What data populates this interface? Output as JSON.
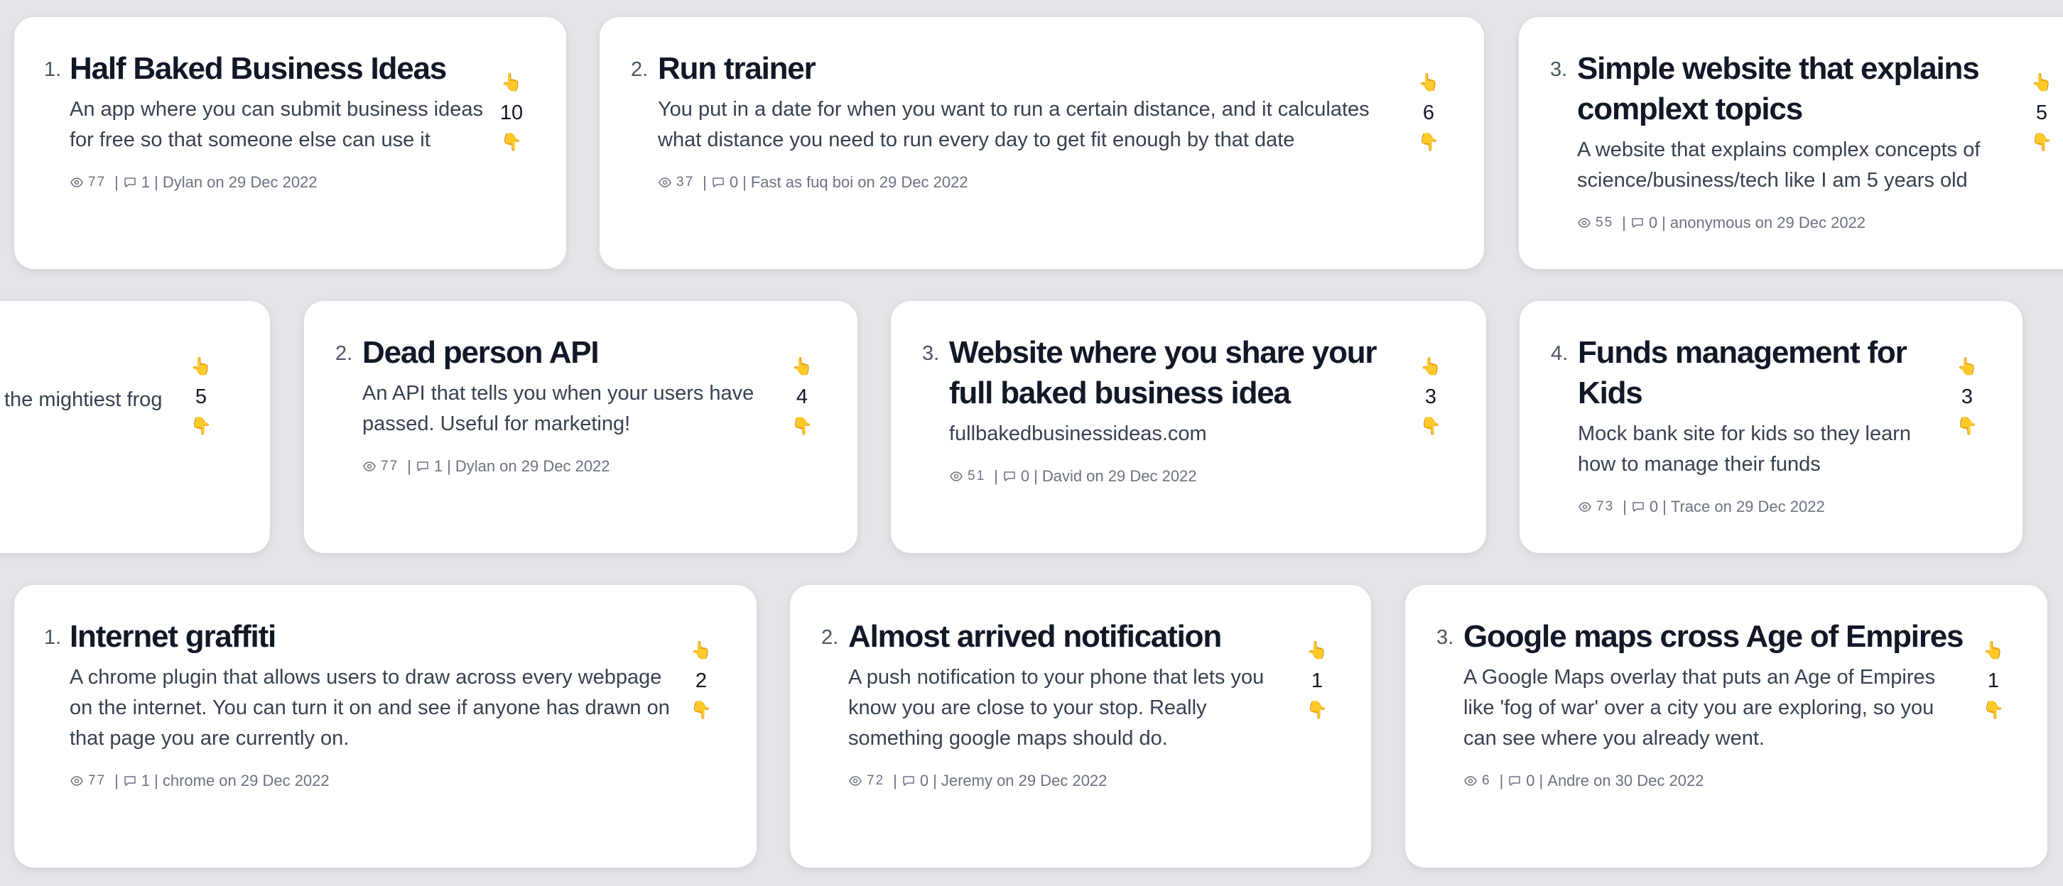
{
  "colors": {
    "background": "#e4e5e9",
    "card": "#ffffff",
    "title": "#111827",
    "muted": "#6b7280"
  },
  "icons": {
    "upvote": "pointing-up-hand-icon",
    "downvote": "pointing-down-hand-icon",
    "views": "eye-icon",
    "comments": "comment-bubble-icon"
  },
  "rows": [
    {
      "cards": [
        {
          "rank": "1.",
          "title": "Half Baked Business Ideas",
          "description": "An app where you can submit business ideas for free so that someone else can use it",
          "views": "77",
          "comments": "1",
          "byline": "Dylan on 29 Dec 2022",
          "votes": "10"
        },
        {
          "rank": "2.",
          "title": "Run trainer",
          "description": "You put in a date for when you want to run a certain distance, and it calculates what distance you need to run every day to get fit enough by that date",
          "views": "37",
          "comments": "0",
          "byline": "Fast as fuq boi on 29 Dec 2022",
          "votes": "6"
        },
        {
          "rank": "3.",
          "title": "Simple website that explains complext topics",
          "description": "A website that explains complex concepts of science/business/tech like I am 5 years old",
          "views": "55",
          "comments": "0",
          "byline": "anonymous on 29 Dec 2022",
          "votes": "5"
        }
      ]
    },
    {
      "cards": [
        {
          "rank": "",
          "title": "",
          "description": "the mightiest frog",
          "views": "",
          "comments": "",
          "byline": "",
          "votes": "5"
        },
        {
          "rank": "2.",
          "title": "Dead person API",
          "description": "An API that tells you when your users have passed. Useful for marketing!",
          "views": "77",
          "comments": "1",
          "byline": "Dylan on 29 Dec 2022",
          "votes": "4"
        },
        {
          "rank": "3.",
          "title": "Website where you share your full baked business idea",
          "description": "fullbakedbusinessideas.com",
          "views": "51",
          "comments": "0",
          "byline": "David on 29 Dec 2022",
          "votes": "3"
        },
        {
          "rank": "4.",
          "title": "Funds management for Kids",
          "description": "Mock bank site for kids so they learn how to manage their funds",
          "views": "73",
          "comments": "0",
          "byline": "Trace on 29 Dec 2022",
          "votes": "3"
        }
      ]
    },
    {
      "cards": [
        {
          "rank": "1.",
          "title": "Internet graffiti",
          "description": "A chrome plugin that allows users to draw across every webpage on the internet. You can turn it on and see if anyone has drawn on that page you are currently on.",
          "views": "77",
          "comments": "1",
          "byline": "chrome on 29 Dec 2022",
          "votes": "2"
        },
        {
          "rank": "2.",
          "title": "Almost arrived notification",
          "description": "A push notification to your phone that lets you know you are close to your stop. Really something google maps should do.",
          "views": "72",
          "comments": "0",
          "byline": "Jeremy on 29 Dec 2022",
          "votes": "1"
        },
        {
          "rank": "3.",
          "title": "Google maps cross Age of Empires",
          "description": "A Google Maps overlay that puts an Age of Empires like 'fog of war' over a city you are exploring, so you can see where you already went.",
          "views": "6",
          "comments": "0",
          "byline": "Andre on 30 Dec 2022",
          "votes": "1"
        }
      ]
    }
  ]
}
